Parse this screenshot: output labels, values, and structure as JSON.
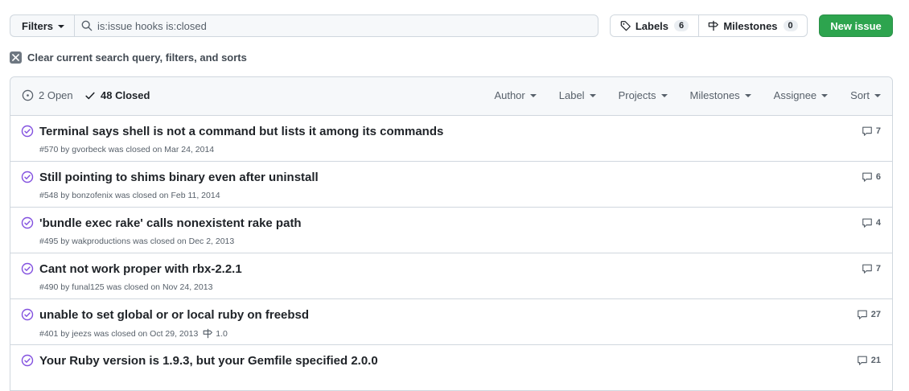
{
  "toolbar": {
    "filters_label": "Filters",
    "search_value": "is:issue hooks is:closed",
    "labels_label": "Labels",
    "labels_count": "6",
    "milestones_label": "Milestones",
    "milestones_count": "0",
    "new_issue_label": "New issue"
  },
  "clear_filters_label": "Clear current search query, filters, and sorts",
  "header": {
    "open_label": "2 Open",
    "closed_label": "48 Closed",
    "menus": [
      "Author",
      "Label",
      "Projects",
      "Milestones",
      "Assignee",
      "Sort"
    ]
  },
  "issues": [
    {
      "title": "Terminal says shell is not a command but lists it among its commands",
      "meta": "#570 by gvorbeck was closed on Mar 24, 2014",
      "milestone": "",
      "comments": "7"
    },
    {
      "title": "Still pointing to shims binary even after uninstall",
      "meta": "#548 by bonzofenix was closed on Feb 11, 2014",
      "milestone": "",
      "comments": "6"
    },
    {
      "title": "'bundle exec rake' calls nonexistent rake path",
      "meta": "#495 by wakproductions was closed on Dec 2, 2013",
      "milestone": "",
      "comments": "4"
    },
    {
      "title": "Cant not work proper with rbx-2.2.1",
      "meta": "#490 by funal125 was closed on Nov 24, 2013",
      "milestone": "",
      "comments": "7"
    },
    {
      "title": "unable to set global or or local ruby on freebsd",
      "meta": "#401 by jeezs was closed on Oct 29, 2013",
      "milestone": "1.0",
      "comments": "27"
    },
    {
      "title": "Your Ruby version is 1.9.3, but your Gemfile specified 2.0.0",
      "meta": "",
      "milestone": "",
      "comments": "21"
    }
  ],
  "colors": {
    "closed_icon": "#8250df",
    "new_issue_bg": "#2da44e",
    "border": "#d0d7de",
    "muted_text": "#57606a"
  }
}
